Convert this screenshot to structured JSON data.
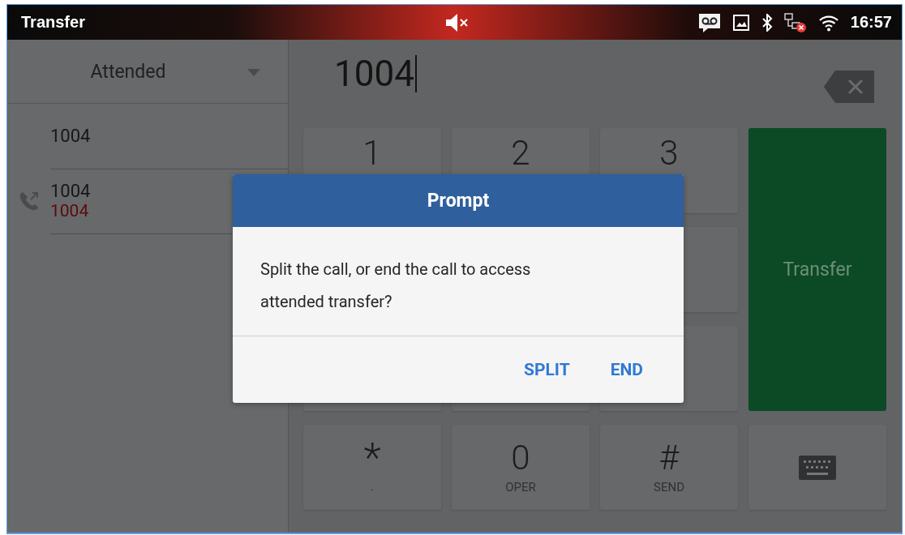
{
  "status_bar": {
    "title": "Transfer",
    "muted": true,
    "time": "16:57"
  },
  "transfer_mode": {
    "label": "Attended"
  },
  "calls": [
    {
      "number": "1004"
    },
    {
      "number": "1004",
      "subtitle": "1004",
      "kind": "active"
    }
  ],
  "dial_field": {
    "value": "1004"
  },
  "keypad": [
    {
      "digit": "1"
    },
    {
      "digit": "2"
    },
    {
      "digit": "3"
    },
    {
      "digit": "*",
      "letters": "."
    },
    {
      "digit": "0",
      "letters": "OPER"
    },
    {
      "digit": "#",
      "letters": "SEND"
    }
  ],
  "transfer_button": {
    "label": "Transfer",
    "disabled": true
  },
  "dialog": {
    "title": "Prompt",
    "message": "Split the call, or end the call to access attended transfer?",
    "buttons": [
      "SPLIT",
      "END"
    ]
  }
}
